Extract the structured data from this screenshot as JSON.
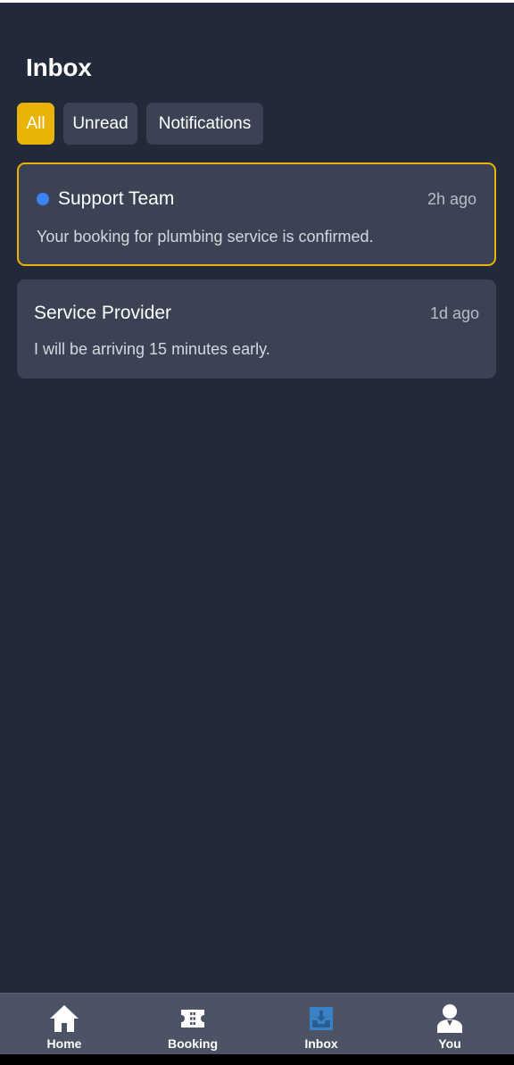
{
  "header": {
    "title": "Inbox"
  },
  "filters": [
    {
      "label": "All",
      "active": true
    },
    {
      "label": "Unread",
      "active": false
    },
    {
      "label": "Notifications",
      "active": false
    }
  ],
  "messages": [
    {
      "sender": "Support Team",
      "time": "2h ago",
      "text": "Your booking for plumbing service is confirmed.",
      "unread": true,
      "selected": true
    },
    {
      "sender": "Service Provider",
      "time": "1d ago",
      "text": "I will be arriving 15 minutes early.",
      "unread": false,
      "selected": false
    }
  ],
  "nav": [
    {
      "label": "Home",
      "icon": "home-icon"
    },
    {
      "label": "Booking",
      "icon": "ticket-icon"
    },
    {
      "label": "Inbox",
      "icon": "inbox-icon",
      "active": true
    },
    {
      "label": "You",
      "icon": "user-icon"
    }
  ],
  "colors": {
    "background": "#222a3a",
    "card": "#3b4253",
    "accent": "#eab308",
    "unread_dot": "#3b82f6",
    "active_nav_icon": "#3b82c4"
  }
}
